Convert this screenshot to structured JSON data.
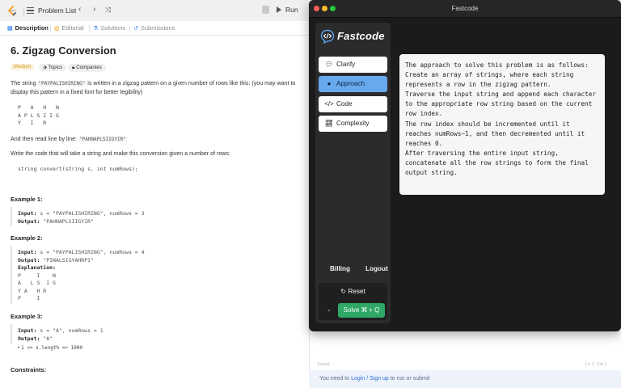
{
  "leetcode": {
    "topbar": {
      "problem_list": "Problem List",
      "run": "Run"
    },
    "tabs": [
      "Description",
      "Editorial",
      "Solutions",
      "Submissions"
    ],
    "problem": {
      "title": "6. Zigzag Conversion",
      "difficulty": "Medium",
      "topics": "Topics",
      "companies": "Companies",
      "intro_pre": "The string ",
      "intro_code": "\"PAYPALISHIRING\"",
      "intro_post": " is written in a zigzag pattern on a given number of rows like this: (you may want to display this pattern in a fixed font for better legibility)",
      "pattern": "P   A   H   N\nA P L S I I G\nY   I   R",
      "readline_pre": "And then read line by line: ",
      "readline_code": "\"PAHNAPLSIIGYIR\"",
      "write_code": "Write the code that will take a string and make this conversion given a number of rows:",
      "signature": "string convert(string s, int numRows);",
      "example1_title": "Example 1:",
      "example1_input_label": "Input:",
      "example1_input": " s = \"PAYPALISHIRING\", numRows = 3",
      "example1_output_label": "Output:",
      "example1_output": " \"PAHNAPLSIIGYIR\"",
      "example2_title": "Example 2:",
      "example2_input_label": "Input:",
      "example2_input": " s = \"PAYPALISHIRING\", numRows = 4",
      "example2_output_label": "Output:",
      "example2_output": " \"PINALSIGYAHRPI\"",
      "example2_expl_label": "Explanation:",
      "example2_expl": "P     I    N\nA   L S  I G\nY A   H R\nP     I",
      "example3_title": "Example 3:",
      "example3_input_label": "Input:",
      "example3_input": " s = \"A\", numRows = 1",
      "example3_output_label": "Output:",
      "example3_output": " \"A\"",
      "constraints_title": "Constraints:",
      "constraint_1": "1 <= s.length <= 1000"
    },
    "editor": {
      "status": "Saved",
      "cursor": "Ln 1, Col 1"
    },
    "login_bar": {
      "pre": "You need to ",
      "link": "Login / Sign up",
      "post": " to run or submit"
    }
  },
  "fastcode": {
    "window_title": "Fastcode",
    "brand": "Fastcode",
    "menu": [
      {
        "label": "Clarify",
        "icon": "chat-bubbles-icon"
      },
      {
        "label": "Approach",
        "icon": "lightbulb-icon"
      },
      {
        "label": "Code",
        "icon": "code-brackets-icon"
      },
      {
        "label": "Complexity",
        "icon": "line-chart-icon"
      }
    ],
    "billing": "Billing",
    "logout": "Logout",
    "reset": "Reset",
    "solve": "Solve ⌘ + Q",
    "answer": "The approach to solve this problem is as follows:\nCreate an array of strings, where each string represents a row in the zigzag pattern.\nTraverse the input string and append each character to the appropriate row string based on the current row index.\nThe row index should be incremented until it reaches numRows−1, and then decremented until it reaches 0.\nAfter traversing the entire input string, concatenate all the row strings to form the final output string.",
    "colors": {
      "active_menu": "#68a9ee",
      "solve_button": "#2fa766",
      "window_bg": "#1b1b1b"
    }
  }
}
